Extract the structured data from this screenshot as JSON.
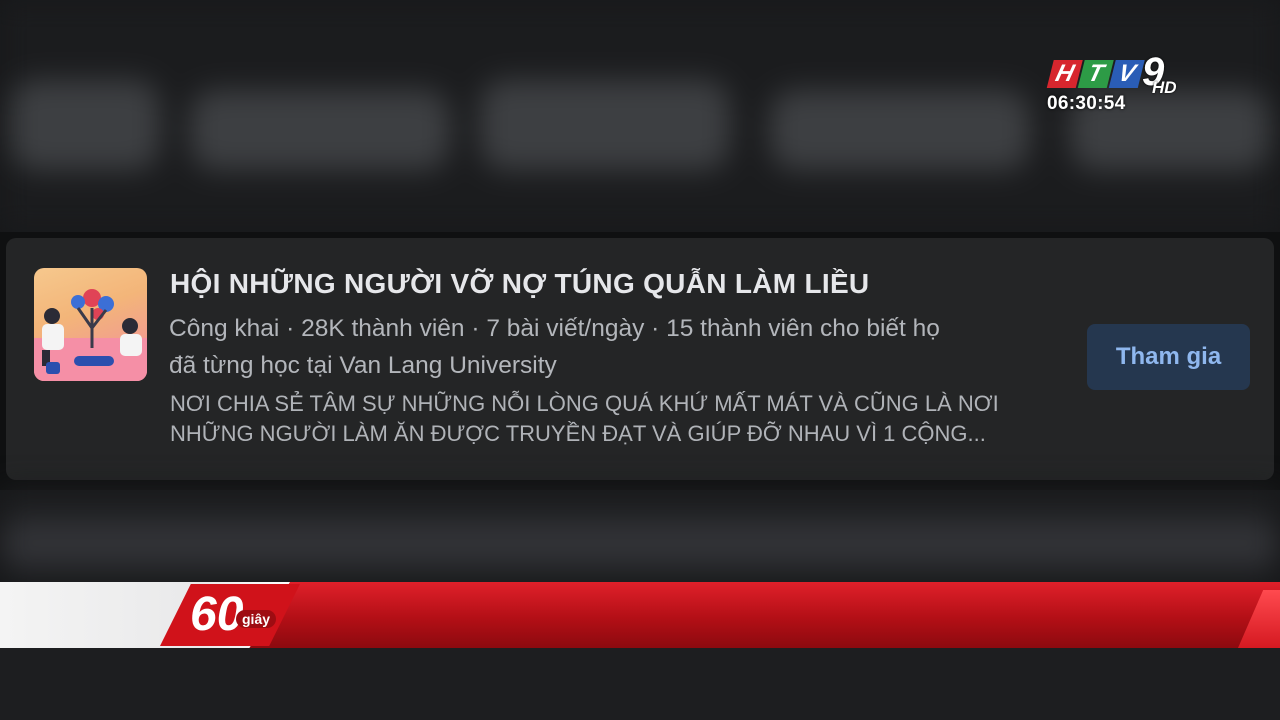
{
  "broadcast": {
    "channel_letters": [
      "H",
      "T",
      "V"
    ],
    "channel_number": "9",
    "channel_quality": "HD",
    "clock": "06:30:54",
    "segment_number": "60",
    "segment_word": "giây"
  },
  "group_card": {
    "name": "HỘI NHỮNG NGƯỜI VỠ NỢ TÚNG QUẪN LÀM LIỀU",
    "meta_line1": "Công khai · 28K thành viên · 7 bài viết/ngày · 15 thành viên cho biết họ",
    "meta_line2": "đã từng học tại Van Lang University",
    "description_line1": "NƠI CHIA SẺ TÂM SỰ NHỮNG NỖI LÒNG QUÁ KHỨ MẤT MÁT VÀ CŨNG LÀ NƠI",
    "description_line2": "NHỮNG NGƯỜI LÀM ĂN ĐƯỢC TRUYỀN ĐẠT VÀ GIÚP ĐỠ NHAU VÌ 1 CỘNG...",
    "join_label": "Tham gia"
  },
  "colors": {
    "card_bg": "#242526",
    "join_bg": "#25374f",
    "join_text": "#8fb7ee",
    "bar_red": "#c4141c"
  }
}
